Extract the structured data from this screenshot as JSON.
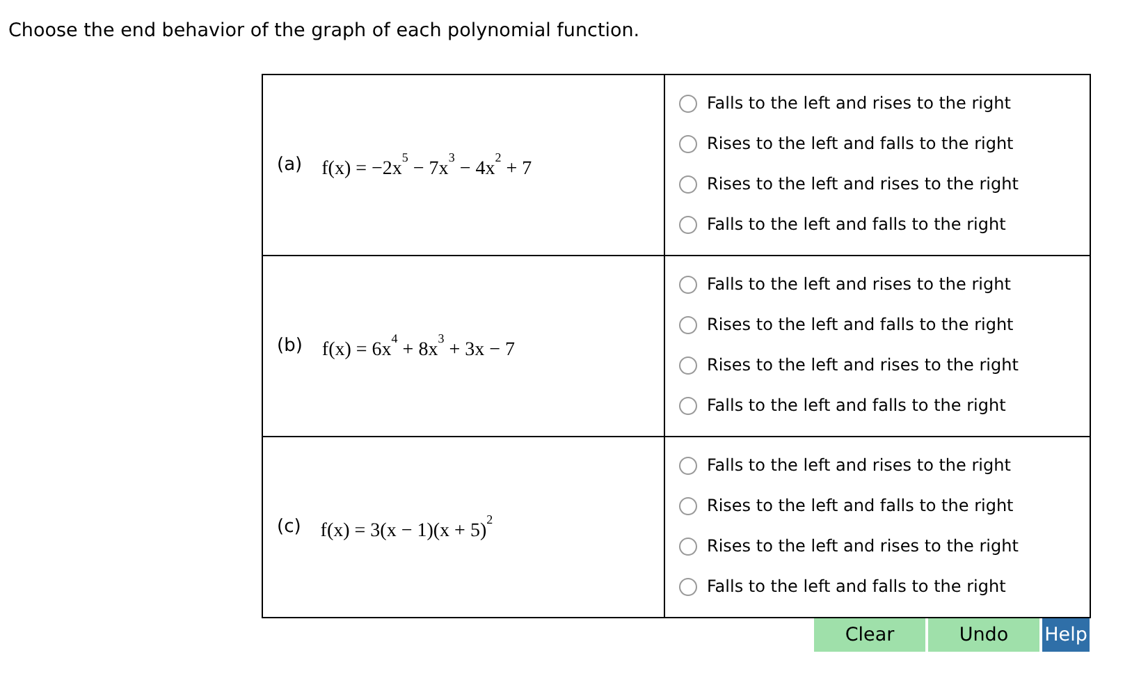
{
  "instruction": "Choose the end behavior of the graph of each polynomial function.",
  "problems": [
    {
      "label": "(a)",
      "formula": "f(x) = −2x$^{5}$ − 7x$^{3}$ − 4x$^{2}$ + 7",
      "options": [
        {
          "text": "Falls to the left and rises to the right",
          "selected": false
        },
        {
          "text": "Rises to the left and falls to the right",
          "selected": false
        },
        {
          "text": "Rises to the left and rises to the right",
          "selected": false
        },
        {
          "text": "Falls to the left and falls to the right",
          "selected": false
        }
      ]
    },
    {
      "label": "(b)",
      "formula": "f(x) = 6x$^{4}$ + 8x$^{3}$ + 3x − 7",
      "options": [
        {
          "text": "Falls to the left and rises to the right",
          "selected": false
        },
        {
          "text": "Rises to the left and falls to the right",
          "selected": false
        },
        {
          "text": "Rises to the left and rises to the right",
          "selected": false
        },
        {
          "text": "Falls to the left and falls to the right",
          "selected": false
        }
      ]
    },
    {
      "label": "(c)",
      "formula": "f(x) = 3(x − 1)(x + 5)$^{2}$",
      "options": [
        {
          "text": "Falls to the left and rises to the right",
          "selected": false
        },
        {
          "text": "Rises to the left and falls to the right",
          "selected": false
        },
        {
          "text": "Rises to the left and rises to the right",
          "selected": false
        },
        {
          "text": "Falls to the left and falls to the right",
          "selected": false
        }
      ]
    }
  ],
  "buttons": [
    {
      "label": "Clear",
      "kind": "action"
    },
    {
      "label": "Undo",
      "kind": "action"
    },
    {
      "label": "Help",
      "kind": "help"
    }
  ]
}
